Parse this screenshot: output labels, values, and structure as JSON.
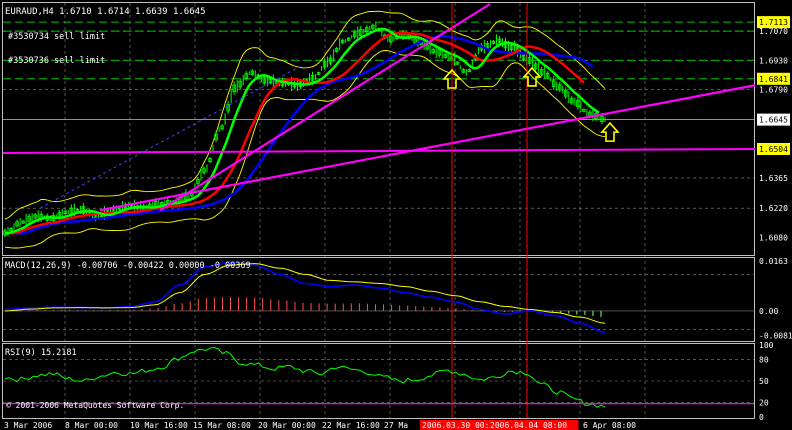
{
  "header": {
    "symbol_line": "EURAUD,H4  1.6710 1.6714 1.6639 1.6645",
    "order_1": "#3530734 sell limit",
    "order_2": "#3530736 sell limit"
  },
  "colors": {
    "background": "#000000",
    "grid": "#c0c0c0",
    "candles": "#00ff00",
    "bollinger": "#ffff00",
    "ma_blue": "#0000ff",
    "ma_red": "#ff0000",
    "ma_green": "#00ff00",
    "trendlines": "#ff00ff",
    "order_lines": "#00ff00",
    "vertical_markers": "#ff0000",
    "macd_line": "#0000ff",
    "macd_signal": "#ffff00",
    "rsi_line": "#00ff00",
    "axis_text": "#ffffff",
    "arrows": "#ffff00"
  },
  "chart_data": [
    {
      "type": "line",
      "panel": "price",
      "ylim": [
        1.6,
        1.72
      ],
      "tick_labels": [
        "1.7113",
        "1.7070",
        "1.6930",
        "1.6841",
        "1.6790",
        "1.6645",
        "1.6504",
        "1.6365",
        "1.6220",
        "1.6080"
      ],
      "highlighted_levels": [
        "1.7113",
        "1.6841",
        "1.6504"
      ],
      "current_price": "1.6645",
      "x_labels": [
        "3 Mar 2006",
        "8 Mar 00:00",
        "10 Mar 16:00",
        "15 Mar 08:00",
        "20 Mar 00:00",
        "22 Mar 16:00",
        "27 Ma",
        "2006.03.30 00:00",
        "2006.04.04 08:00",
        "6 Apr 08:00"
      ],
      "series": [
        {
          "values": [
            1.61,
            1.615,
            1.618,
            1.617,
            1.62,
            1.621,
            1.618,
            1.621,
            1.623,
            1.622,
            1.624,
            1.625,
            1.628,
            1.64,
            1.66,
            1.68,
            1.687,
            1.683,
            1.682,
            1.681,
            1.684,
            1.692,
            1.702,
            1.706,
            1.709,
            1.703,
            1.705,
            1.701,
            1.697,
            1.694,
            1.687,
            1.699,
            1.702,
            1.699,
            1.693,
            1.687,
            1.68,
            1.673,
            1.667,
            1.6645
          ]
        }
      ],
      "arrows": [
        "up",
        "up",
        "up"
      ]
    },
    {
      "type": "line",
      "panel": "macd",
      "title": "MACD(12,26,9) -0.00706 -0.00422 0.00000 -0.00369",
      "tick_labels": [
        "0.0163",
        "0.00",
        "-0.0081"
      ],
      "ylim": [
        -0.0095,
        0.017
      ],
      "series": [
        {
          "values": [
            0.0005,
            0.001,
            0.0012,
            0.0011,
            0.001,
            0.0014,
            0.003,
            0.0085,
            0.0145,
            0.016,
            0.015,
            0.012,
            0.009,
            0.008,
            0.0085,
            0.0075,
            0.006,
            0.0045,
            0.003,
            0.0005,
            -0.001,
            0.0,
            -0.0015,
            -0.004,
            -0.007
          ]
        },
        {
          "values": [
            0.0,
            0.0006,
            0.001,
            0.0011,
            0.001,
            0.0011,
            0.002,
            0.006,
            0.012,
            0.015,
            0.0155,
            0.014,
            0.012,
            0.01,
            0.0095,
            0.009,
            0.008,
            0.0065,
            0.005,
            0.003,
            0.0015,
            0.0005,
            -0.0005,
            -0.002,
            -0.004
          ]
        }
      ]
    },
    {
      "type": "line",
      "panel": "rsi",
      "title": "RSI(9) 15.2181",
      "tick_labels": [
        "100",
        "80",
        "50",
        "20",
        "0"
      ],
      "ylim": [
        0,
        100
      ],
      "series": [
        {
          "values": [
            55,
            52,
            58,
            60,
            53,
            50,
            57,
            62,
            60,
            65,
            70,
            82,
            92,
            95,
            88,
            75,
            72,
            67,
            70,
            64,
            60,
            70,
            66,
            62,
            55,
            50,
            52,
            58,
            65,
            60,
            52,
            55,
            64,
            62,
            45,
            35,
            25,
            18,
            15
          ]
        }
      ]
    }
  ],
  "footer": {
    "copyright": "© 2001-2006 MetaQuotes Software Corp."
  }
}
